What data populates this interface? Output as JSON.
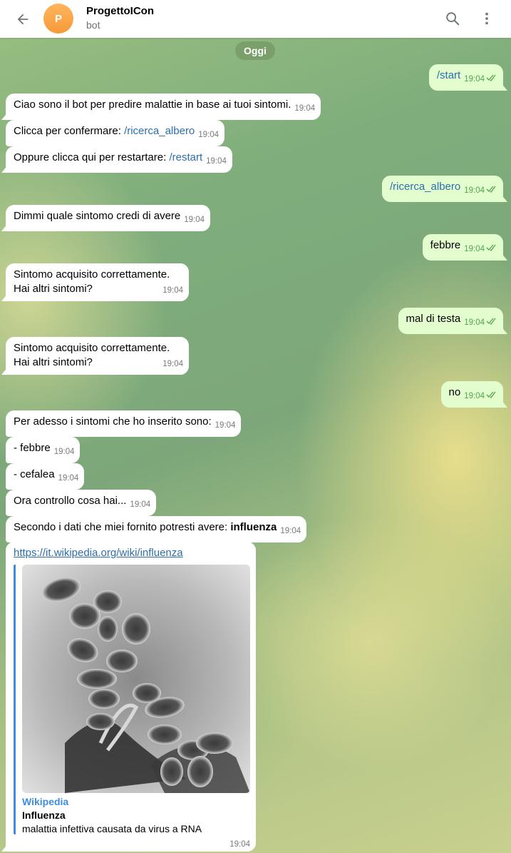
{
  "header": {
    "chat_title": "ProgettoICon",
    "status": "bot",
    "avatar_letter": "P",
    "icons": [
      "back-arrow-icon",
      "search-icon",
      "more-vertical-icon"
    ]
  },
  "date_label": "Oggi",
  "messages": [
    {
      "dir": "out",
      "text": "/start",
      "time": "19:04",
      "read": true
    },
    {
      "dir": "in",
      "text": "Ciao sono il bot per predire malattie in base ai tuoi sintomi.",
      "time": "19:04"
    },
    {
      "dir": "in",
      "text": "Clicca per confermare: ",
      "cmd": "/ricerca_albero",
      "time": "19:04"
    },
    {
      "dir": "in",
      "text": "Oppure clicca qui per restartare: ",
      "cmd": "/restart",
      "time": "19:04"
    },
    {
      "dir": "out",
      "text": "/ricerca_albero",
      "time": "19:04",
      "read": true
    },
    {
      "dir": "in",
      "text": "Dimmi quale sintomo credi di avere",
      "time": "19:04"
    },
    {
      "dir": "out",
      "text": "febbre",
      "time": "19:04",
      "read": true
    },
    {
      "dir": "in",
      "line1": "Sintomo acquisito correttamente.",
      "line2": "Hai altri sintomi?",
      "time": "19:04"
    },
    {
      "dir": "out",
      "text": "mal di testa",
      "time": "19:04",
      "read": true
    },
    {
      "dir": "in",
      "line1": "Sintomo acquisito correttamente.",
      "line2": "Hai altri sintomi?",
      "time": "19:04"
    },
    {
      "dir": "out",
      "text": "no",
      "time": "19:04",
      "read": true
    },
    {
      "dir": "in",
      "text": "Per adesso i sintomi che ho inserito sono:",
      "time": "19:04"
    },
    {
      "dir": "in",
      "text": "- febbre",
      "time": "19:04"
    },
    {
      "dir": "in",
      "text": "- cefalea",
      "time": "19:04"
    },
    {
      "dir": "in",
      "text": "Ora controllo cosa hai...",
      "time": "19:04"
    },
    {
      "dir": "in",
      "text": "Secondo i dati che miei fornito potresti avere: ",
      "bold": "influenza",
      "time": "19:04"
    }
  ],
  "link_preview": {
    "url": "https://it.wikipedia.org/wiki/influenza",
    "site_name": "Wikipedia",
    "title": "Influenza",
    "description": "malattia infettiva causata da virus a RNA",
    "time": "19:04"
  },
  "colors": {
    "incoming_bubble": "#ffffff",
    "outgoing_bubble": "#e3fdcf",
    "link": "#2b6fad",
    "read_ticks": "#53a451",
    "preview_accent": "#3d8de0"
  }
}
